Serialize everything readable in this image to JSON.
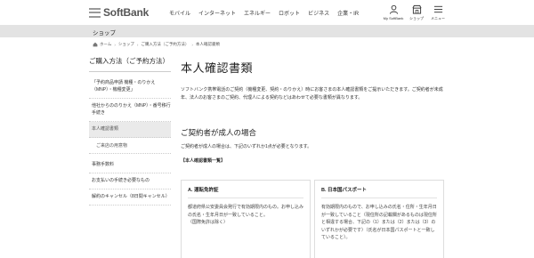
{
  "header": {
    "logo_text": "SoftBank",
    "nav": [
      "モバイル",
      "インターネット",
      "エネルギー",
      "ロボット",
      "ビジネス",
      "企業・IR"
    ],
    "util": [
      {
        "label": "My SoftBank",
        "icon": "user-icon"
      },
      {
        "label": "ショップ",
        "icon": "shop-icon"
      },
      {
        "label": "メニュー",
        "icon": "menu-icon"
      }
    ]
  },
  "category": "ショップ",
  "breadcrumb": [
    "ホーム",
    "ショップ",
    "ご購入方法（ご予約方法）",
    "本人確認書類"
  ],
  "sidebar": {
    "title": "ご購入方法（ご予約方法）",
    "items": [
      {
        "label": "「予約商品申請 機種・のりかえ（MNP）・機種変更」",
        "active": false
      },
      {
        "label": "他社からののりかえ（MNP）・番号移行手続き",
        "active": false
      },
      {
        "label": "本人確認書類",
        "active": true
      }
    ],
    "sub": [
      "ご来店の用意物"
    ],
    "items2": [
      "事務手数料",
      "お支払いの手続き必要なもの",
      "解約のキャンセル（8日間キャンセル）"
    ]
  },
  "main": {
    "title": "本人確認書類",
    "intro": "ソフトバンク携帯電話のご契約（機種変更、契約・のりかえ）時にお客さまの本人確認書類をご提示いただきます。ご契約者が未成年、法人のお客さまのご契約、代理人による契約などはあわせて必要な書類が異なります。",
    "section_title": "ご契約者が成人の場合",
    "section_text": "ご契約者が成人の場合は、下記のいずれか1点が必要となります。",
    "docs_label": "【本人確認書類一覧】",
    "cards": [
      {
        "title": "A. 運転免許証",
        "body": "都道府県公安委員会発行で有効期限内のもの。お申し込みの氏名・生年月日が一致していること。",
        "note": "（国際免許は除く）"
      },
      {
        "title": "B. 日本国パスポート",
        "body": "有効期限内のもので、お申し込みの氏名・住所・生年月日が一致していること（現住所の記載欄があるものは現住所と相違する場合、下記の（1）または（2）または（3）のいずれかが必要です）（氏名が日本国パスポートと一致していること）。",
        "note": ""
      }
    ]
  }
}
